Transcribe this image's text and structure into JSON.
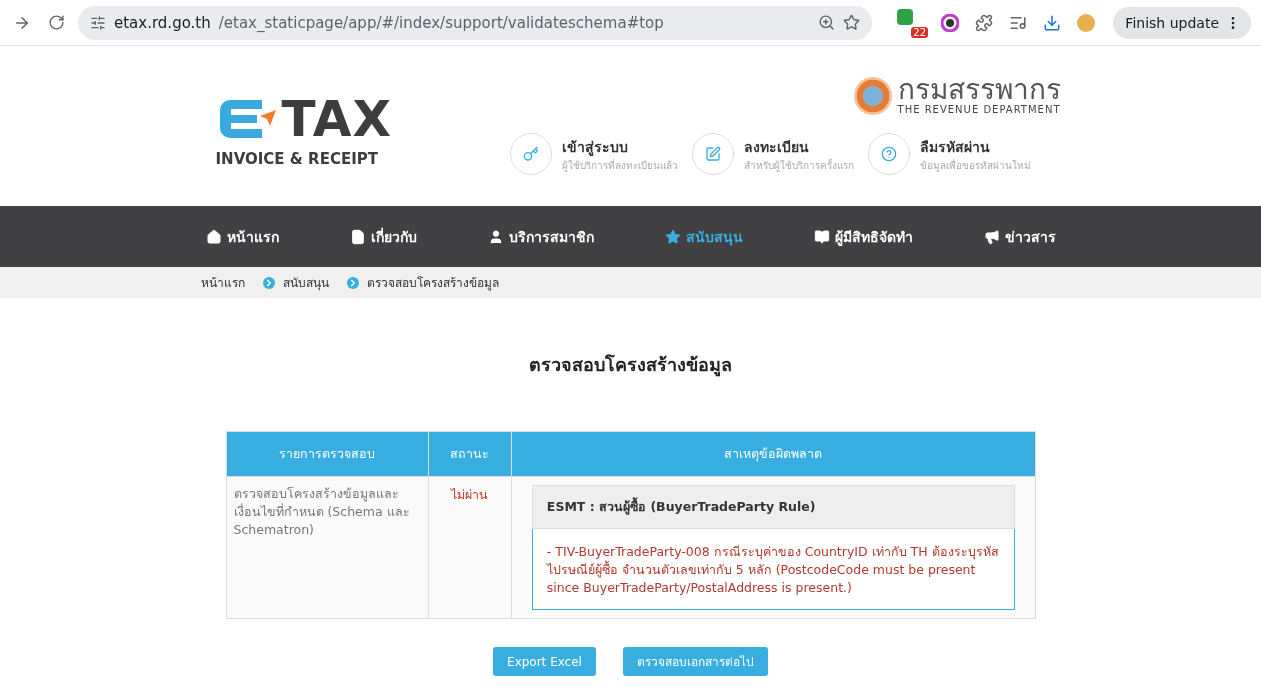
{
  "browser": {
    "url_host": "etax.rd.go.th",
    "url_path": "/etax_staticpage/app/#/index/support/validateschema#top",
    "extension_badge": "22",
    "update_button": "Finish update"
  },
  "header": {
    "logo_word": "TAX",
    "logo_tagline": "INVOICE & RECEIPT",
    "department_thai": "กรมสรรพากร",
    "department_english": "THE REVENUE DEPARTMENT",
    "links": [
      {
        "kind": "login",
        "title": "เข้าสู่ระบบ",
        "subtitle": "ผู้ใช้บริการที่ลงทะเบียนแล้ว"
      },
      {
        "kind": "register",
        "title": "ลงทะเบียน",
        "subtitle": "สำหรับผู้ใช้บริการครั้งแรก"
      },
      {
        "kind": "forgot",
        "title": "ลืมรหัสผ่าน",
        "subtitle": "ข้อมูลเพื่อขอรหัสผ่านใหม่"
      }
    ]
  },
  "nav": [
    {
      "kind": "home",
      "label": "หน้าแรก",
      "selected": false
    },
    {
      "kind": "about",
      "label": "เกี่ยวกับ",
      "selected": false
    },
    {
      "kind": "member",
      "label": "บริการสมาชิก",
      "selected": false
    },
    {
      "kind": "support",
      "label": "สนับสนุน",
      "selected": true
    },
    {
      "kind": "eligible",
      "label": "ผู้มีสิทธิจัดทำ",
      "selected": false
    },
    {
      "kind": "news",
      "label": "ข่าวสาร",
      "selected": false
    }
  ],
  "breadcrumb": [
    "หน้าแรก",
    "สนับสนุน",
    "ตรวจสอบโครงสร้างข้อมูล"
  ],
  "page_title": "ตรวจสอบโครงสร้างข้อมูล",
  "table": {
    "columns": [
      "รายการตรวจสอบ",
      "สถานะ",
      "สาเหตุข้อผิดพลาด"
    ],
    "rows": [
      {
        "check": "ตรวจสอบโครงสร้างข้อมูลและเงื่อนไขที่กำหนด (Schema และ Schematron)",
        "status": "ไม่ผ่าน",
        "passed": false,
        "errors": [
          {
            "title": "ESMT : สวนผู้ซื้อ (BuyerTradeParty Rule)",
            "message": "- TIV-BuyerTradeParty-008 กรณีระบุค่าของ CountryID เท่ากับ TH ต้องระบุรหัสไปรษณีย์ผู้ซื้อ จำนวนตัวเลขเท่ากับ 5 หลัก (PostcodeCode must be present since BuyerTradeParty/PostalAddress is present.)"
          }
        ]
      }
    ]
  },
  "buttons": [
    "Export Excel",
    "ตรวจสอบเอกสารต่อไป"
  ]
}
